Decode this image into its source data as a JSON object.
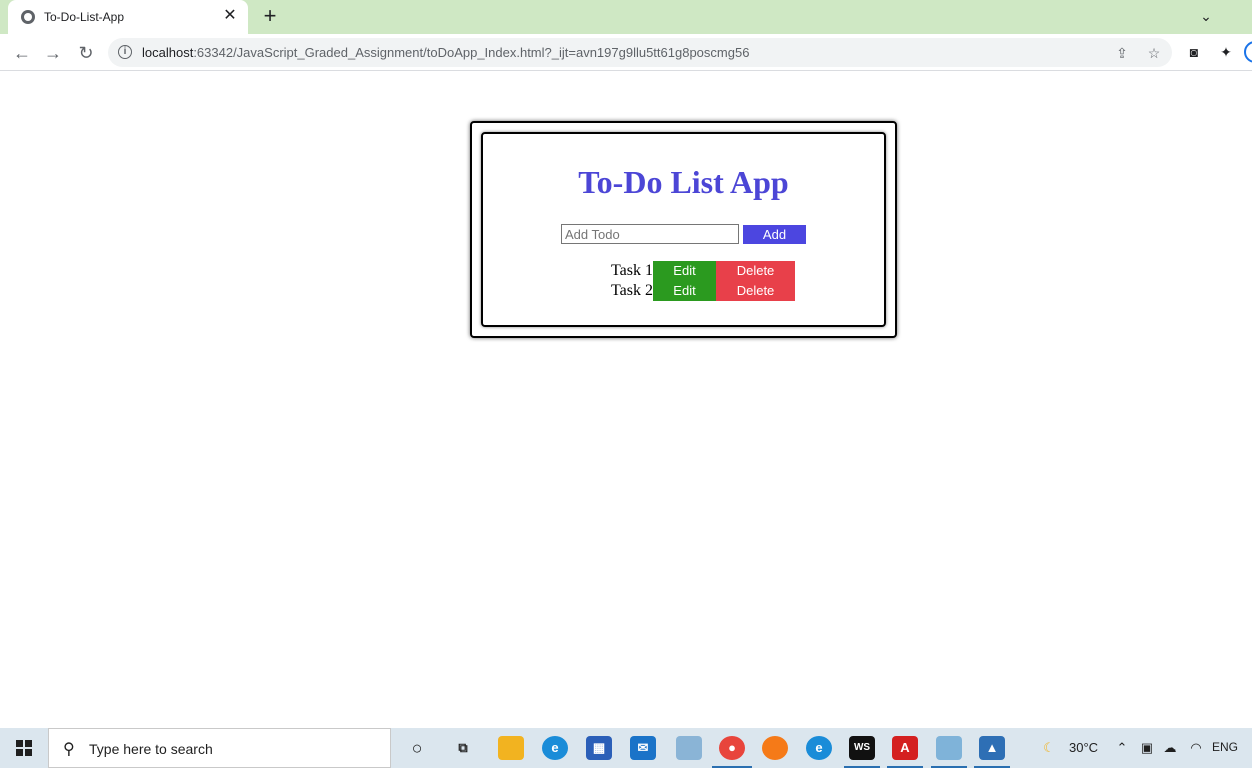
{
  "browser": {
    "tab_title": "To-Do-List-App",
    "tab_close": "✕",
    "new_tab": "+",
    "tab_menu": "⌄",
    "url_host": "localhost",
    "url_rest": ":63342/JavaScript_Graded_Assignment/toDoApp_Index.html?_ijt=avn197g9llu5tt61g8poscmg56",
    "back": "←",
    "forward": "→",
    "reload": "↻"
  },
  "app": {
    "title": "To-Do List App",
    "input_placeholder": "Add Todo",
    "add_label": "Add",
    "tasks": [
      {
        "label": "Task 1",
        "edit": "Edit",
        "delete": "Delete"
      },
      {
        "label": "Task 2",
        "edit": "Edit",
        "delete": "Delete"
      }
    ],
    "colors": {
      "title": "#4c46d6",
      "add": "#4c46e0",
      "edit": "#2b9a1f",
      "delete": "#e8404a"
    }
  },
  "taskbar": {
    "search_placeholder": "Type here to search",
    "weather": "30°C",
    "language": "ENG",
    "apps": [
      "task-view",
      "widgets",
      "file-explorer",
      "edge",
      "microsoft-store",
      "mail",
      "remote-desktop",
      "chrome",
      "firefox",
      "edge-dev",
      "webstorm",
      "acrobat",
      "notepad",
      "photos"
    ]
  }
}
